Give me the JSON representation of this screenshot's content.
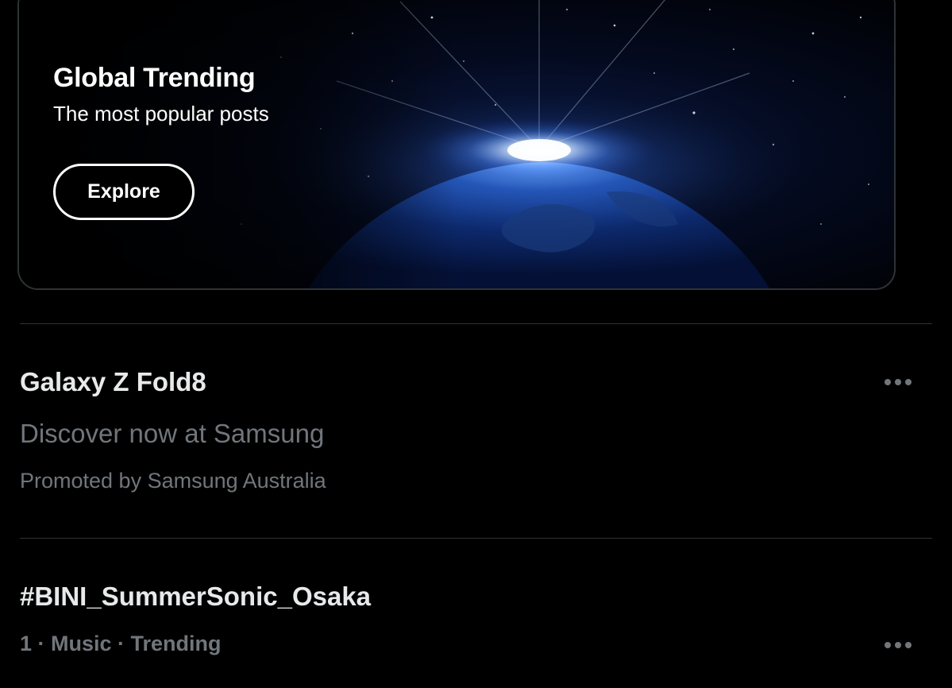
{
  "banner": {
    "title": "Global Trending",
    "subtitle": "The most popular posts",
    "button_label": "Explore",
    "image": "earth-from-space-sunrise"
  },
  "trends": [
    {
      "title": "Galaxy Z Fold8",
      "description": "Discover now at Samsung",
      "meta": "Promoted by Samsung Australia",
      "more_icon": "ellipsis-icon"
    },
    {
      "title": "#BINI_SummerSonic_Osaka",
      "meta": "1 · Music · Trending",
      "more_icon": "ellipsis-icon"
    }
  ],
  "colors": {
    "background": "#000000",
    "primary_text": "#e7e9ea",
    "secondary_text": "#71767b",
    "divider": "#2f3336"
  }
}
